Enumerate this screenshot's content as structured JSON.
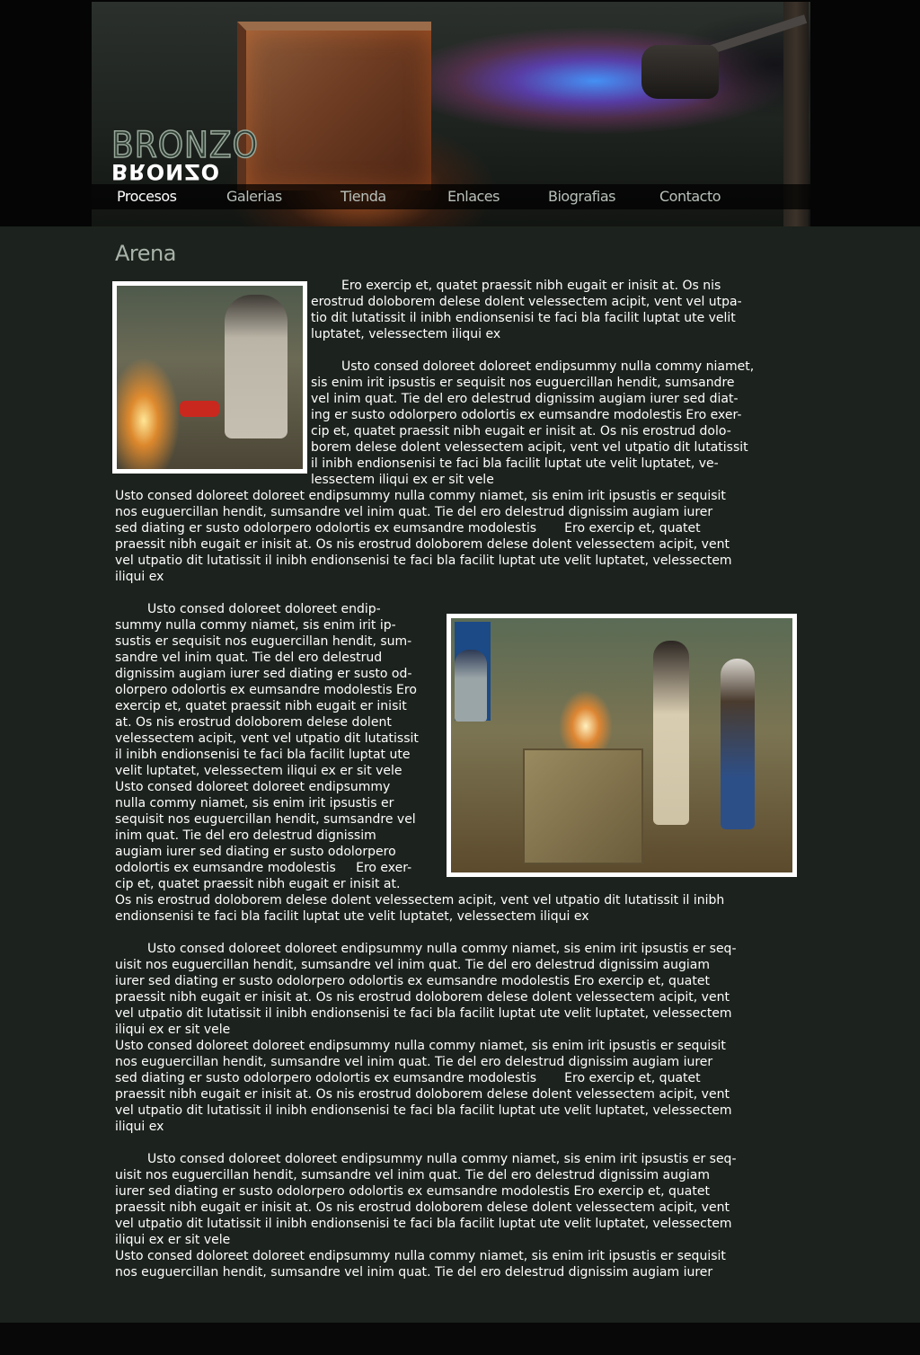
{
  "site": {
    "logo_text": "BRONZO",
    "logo_mirror_text": "BRONZO"
  },
  "nav": {
    "items": [
      {
        "label": "Procesos",
        "active": true
      },
      {
        "label": "Galerias",
        "active": false
      },
      {
        "label": "Tienda",
        "active": false
      },
      {
        "label": "Enlaces",
        "active": false
      },
      {
        "label": "Biografias",
        "active": false
      },
      {
        "label": "Contacto",
        "active": false
      }
    ]
  },
  "page": {
    "title": "Arena"
  },
  "content": {
    "p1": [
      "Ero exercip et, quatet praessit nibh eugait er inisit at. Os nis",
      "erostrud doloborem delese dolent velessectem acipit, vent vel utpa-",
      "tio dit lutatissit il inibh endionsenisi te faci bla facilit luptat ute velit",
      "luptatet, velessectem iliqui ex"
    ],
    "p2": [
      "Usto consed doloreet doloreet endipsummy nulla commy niamet,",
      "sis enim irit ipsustis er sequisit nos euguercillan hendit, sumsandre",
      "vel inim quat. Tie del ero delestrud dignissim augiam iurer sed diat-",
      "ing er susto odolorpero odolortis ex eumsandre modolestis Ero exer-",
      "cip et, quatet praessit nibh eugait er inisit at. Os nis erostrud dolo-",
      "borem delese dolent velessectem acipit, vent vel utpatio dit lutatissit",
      "il inibh endionsenisi te faci bla facilit luptat ute velit luptatet, ve-",
      "lessectem iliqui ex er sit vele"
    ],
    "p3": [
      "Usto consed doloreet doloreet endipsummy nulla commy niamet, sis enim irit ipsustis er sequisit",
      "nos euguercillan hendit, sumsandre vel inim quat. Tie del ero delestrud dignissim augiam iurer",
      "sed diating er susto odolorpero odolortis ex eumsandre modolestis       Ero exercip et, quatet",
      "praessit nibh eugait er inisit at. Os nis erostrud doloborem delese dolent velessectem acipit, vent",
      "vel utpatio dit lutatissit il inibh endionsenisi te faci bla facilit luptat ute velit luptatet, velessectem",
      "iliqui ex"
    ],
    "p4": [
      "Usto consed doloreet doloreet endip-",
      "summy nulla commy niamet, sis enim irit ip-",
      "sustis er sequisit nos euguercillan hendit, sum-",
      "sandre vel inim quat. Tie del ero delestrud",
      "dignissim augiam iurer sed diating er susto od-",
      "olorpero odolortis ex eumsandre modolestis Ero",
      "exercip et, quatet praessit nibh eugait er inisit",
      "at. Os nis erostrud doloborem delese dolent",
      "velessectem acipit, vent vel utpatio dit lutatissit",
      "il inibh endionsenisi te faci bla facilit luptat ute",
      "velit luptatet, velessectem iliqui ex er sit vele",
      "Usto consed doloreet doloreet endipsummy",
      "nulla commy niamet, sis enim irit ipsustis er",
      "sequisit nos euguercillan hendit, sumsandre vel",
      "inim quat. Tie del ero delestrud dignissim",
      "augiam iurer sed diating er susto odolorpero",
      "odolortis ex eumsandre modolestis     Ero exer-",
      "cip et, quatet praessit nibh eugait er inisit at."
    ],
    "p5": [
      "Os nis erostrud doloborem delese dolent velessectem acipit, vent vel utpatio dit lutatissit il inibh",
      "endionsenisi te faci bla facilit luptat ute velit luptatet, velessectem iliqui ex"
    ],
    "p6": [
      "Usto consed doloreet doloreet endipsummy nulla commy niamet, sis enim irit ipsustis er seq-",
      "uisit nos euguercillan hendit, sumsandre vel inim quat. Tie del ero delestrud dignissim augiam",
      "iurer sed diating er susto odolorpero odolortis ex eumsandre modolestis Ero exercip et, quatet",
      "praessit nibh eugait er inisit at. Os nis erostrud doloborem delese dolent velessectem acipit, vent",
      "vel utpatio dit lutatissit il inibh endionsenisi te faci bla facilit luptat ute velit luptatet, velessectem",
      "iliqui ex er sit vele",
      "Usto consed doloreet doloreet endipsummy nulla commy niamet, sis enim irit ipsustis er sequisit",
      "nos euguercillan hendit, sumsandre vel inim quat. Tie del ero delestrud dignissim augiam iurer",
      "sed diating er susto odolorpero odolortis ex eumsandre modolestis       Ero exercip et, quatet",
      "praessit nibh eugait er inisit at. Os nis erostrud doloborem delese dolent velessectem acipit, vent",
      "vel utpatio dit lutatissit il inibh endionsenisi te faci bla facilit luptat ute velit luptatet, velessectem",
      "iliqui ex"
    ],
    "p7": [
      "Usto consed doloreet doloreet endipsummy nulla commy niamet, sis enim irit ipsustis er seq-",
      "uisit nos euguercillan hendit, sumsandre vel inim quat. Tie del ero delestrud dignissim augiam",
      "iurer sed diating er susto odolorpero odolortis ex eumsandre modolestis Ero exercip et, quatet",
      "praessit nibh eugait er inisit at. Os nis erostrud doloborem delese dolent velessectem acipit, vent",
      "vel utpatio dit lutatissit il inibh endionsenisi te faci bla facilit luptat ute velit luptatet, velessectem",
      "iliqui ex er sit vele",
      "Usto consed doloreet doloreet endipsummy nulla commy niamet, sis enim irit ipsustis er sequisit",
      "nos euguercillan hendit, sumsandre vel inim quat. Tie del ero delestrud dignissim augiam iurer"
    ]
  },
  "images": {
    "left_photo": "foundry-worker-pouring-photo",
    "right_photo": "foundry-team-casting-photo"
  }
}
